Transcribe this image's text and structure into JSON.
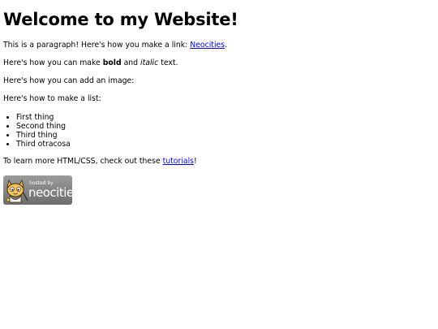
{
  "heading": "Welcome to my Website!",
  "para_link": {
    "before": "This is a paragraph! Here's how you make a link: ",
    "link_text": "Neocities",
    "after": "."
  },
  "para_bold": {
    "before": "Here's how you can make ",
    "bold": "bold",
    "middle": " and ",
    "italic": "italic",
    "after": " text."
  },
  "para_image": "Here's how you can add an image:",
  "para_list": "Here's how to make a list:",
  "list_items": [
    "First thing",
    "Second thing",
    "Third thing",
    "Third otracosa"
  ],
  "para_learn": {
    "before": "To learn more HTML/CSS, check out these ",
    "link_text": "tutorials",
    "after": "!"
  },
  "badge": {
    "line1": "hosted by",
    "line2": "neocities",
    "icon": "neocities-cat-icon"
  },
  "colors": {
    "link": "#0000ee",
    "badge_bg": "#8a8a8a"
  }
}
